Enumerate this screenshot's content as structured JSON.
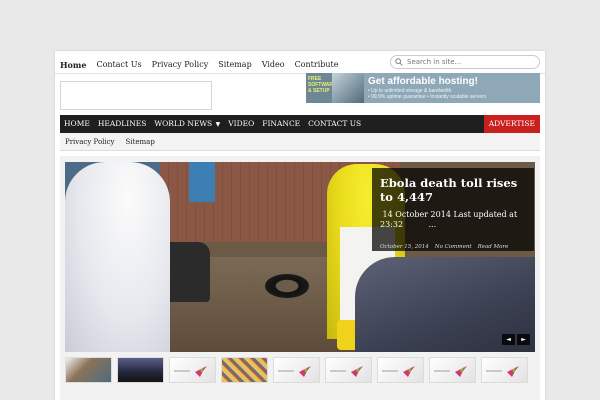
{
  "topnav": {
    "items": [
      "Home",
      "Contact Us",
      "Privacy Policy",
      "Sitemap",
      "Video",
      "Contribute"
    ],
    "search_placeholder": "Search in site..."
  },
  "banner": {
    "left_text": "FREE SOFTWARE & SETUP",
    "title": "Get affordable hosting!",
    "bullets": [
      "• Up to unlimited storage & bandwidth",
      "• 99.9% uptime guarantee  • Instantly scalable servers"
    ]
  },
  "mainnav": {
    "items": [
      "HOME",
      "HEADLINES",
      "WORLD NEWS",
      "VIDEO",
      "FINANCE",
      "CONTACT US"
    ],
    "caret": "▼",
    "advertise": "ADVERTISE"
  },
  "subnav": {
    "items": [
      "Privacy Policy",
      "Sitemap"
    ]
  },
  "slide": {
    "title": "Ebola death toll rises to 4,447",
    "excerpt": " 14 October 2014 Last updated at\n23:32          ...",
    "date": "October 15, 2014",
    "comments": "No Comment",
    "read_more": "Read More",
    "prev": "◄",
    "next": "►"
  },
  "thumbs": {
    "count_label": "10"
  },
  "colors": {
    "nav_bg": "#1f1f1f",
    "advertise_bg": "#c9201f",
    "banner_bg": "#8fa8b8"
  }
}
